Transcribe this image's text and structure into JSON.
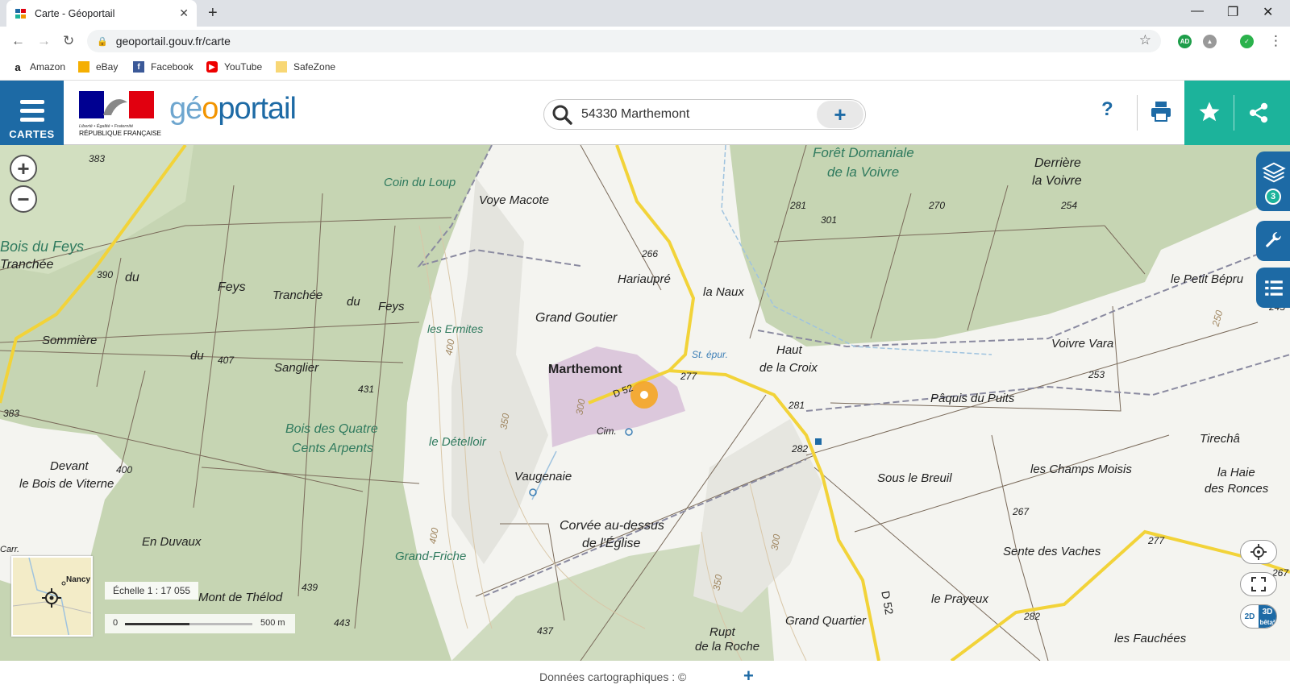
{
  "browser": {
    "tab_title": "Carte - Géoportail",
    "url": "geoportail.gouv.fr/carte",
    "bookmarks": [
      "Amazon",
      "eBay",
      "Facebook",
      "YouTube",
      "SafeZone"
    ]
  },
  "header": {
    "menu_label": "CARTES",
    "logo_motto": "Liberté • Égalité • Fraternité",
    "logo_country": "RÉPUBLIQUE FRANÇAISE",
    "brand_part1": "gé",
    "brand_part2": "o",
    "brand_part3": "portail",
    "search_value": "54330 Marthemont",
    "help_label": "?"
  },
  "map": {
    "layers_count": "3",
    "labels": {
      "coin_du_loup": "Coin du Loup",
      "voye_macote": "Voye Macote",
      "foret_domaniale": "Forêt Domaniale",
      "de_la_voivre": "de la Voivre",
      "derriere": "Derrière",
      "la_voivre": "la Voivre",
      "bois_du_feys": "Bois du Feys",
      "tranchee1": "Tranchée",
      "du1": "du",
      "feys1": "Feys",
      "tranchee2": "Tranchée",
      "du2": "du",
      "feys2": "Feys",
      "sommiere": "Sommière",
      "du3": "du",
      "sanglier": "Sanglier",
      "les_ermites": "les Ermites",
      "hariaupre": "Hariaupré",
      "la_naux": "la Naux",
      "grand_goutier": "Grand Goutier",
      "marthemont": "Marthemont",
      "st_epur": "St. épur.",
      "haut": "Haut",
      "de_la_croix": "de la Croix",
      "le_petit_bepru": "le Petit Bépru",
      "voivre_vara": "Voivre Vara",
      "paquis_du_puits": "Pâquis du Puits",
      "bois_des_quatre": "Bois des Quatre",
      "cents_arpents": "Cents Arpents",
      "le_detelloir": "le Dételloir",
      "cim": "Cim.",
      "vaugenaie": "Vaugenaie",
      "devant": "Devant",
      "le_bois_de_viterne": "le Bois de Viterne",
      "sous_le_breuil": "Sous le Breuil",
      "les_champs_moisis": "les Champs Moisis",
      "tiracha": "Tirechâ",
      "la_haie": "la Haie",
      "des_ronces": "des Ronces",
      "en_duvaux": "En Duvaux",
      "corvee": "Corvée au-dessus",
      "de_leglise": "de l'Église",
      "grand_friche": "Grand-Friche",
      "sente_des_vaches": "Sente des Vaches",
      "mont_de_thelod": "Mont de Thélod",
      "le_prayeux": "le Prayeux",
      "grand_quartier": "Grand Quartier",
      "rupt": "Rupt",
      "de_la_roche": "de la Roche",
      "les_fauchees": "les Fauchées",
      "carr": "Carr.",
      "d52": "D 52",
      "d52b": "D 52"
    },
    "altitudes": {
      "a383a": "383",
      "a390": "390",
      "a407": "407",
      "a431": "431",
      "a383b": "383",
      "a400a": "400",
      "a266": "266",
      "a277a": "277",
      "a281a": "281",
      "a301": "301",
      "a270": "270",
      "a254": "254",
      "a253": "253",
      "a281b": "281",
      "a282a": "282",
      "a267a": "267",
      "a277b": "277",
      "a267b": "267",
      "a282b": "282",
      "a439": "439",
      "a443": "443",
      "a437": "437",
      "a300a": "300",
      "a350a": "350",
      "a400b": "400",
      "a400c": "400",
      "a300b": "300",
      "a350b": "350",
      "a245": "245",
      "a250": "250"
    },
    "minimap_city": "Nancy",
    "scale_text": "Échelle 1 : 17 055",
    "scale_zero": "0",
    "scale_end": "500 m",
    "btn_2d": "2D",
    "btn_3d": "3D",
    "btn_beta": "bêta²"
  },
  "footer": {
    "credit": "Données cartographiques : ©",
    "plus": "+"
  },
  "colors": {
    "brand_blue": "#1d6aa5",
    "brand_green": "#1cb39b",
    "marker_orange": "#f5a623",
    "forest": "#c9d7b6",
    "road_yellow": "#f2d339"
  }
}
